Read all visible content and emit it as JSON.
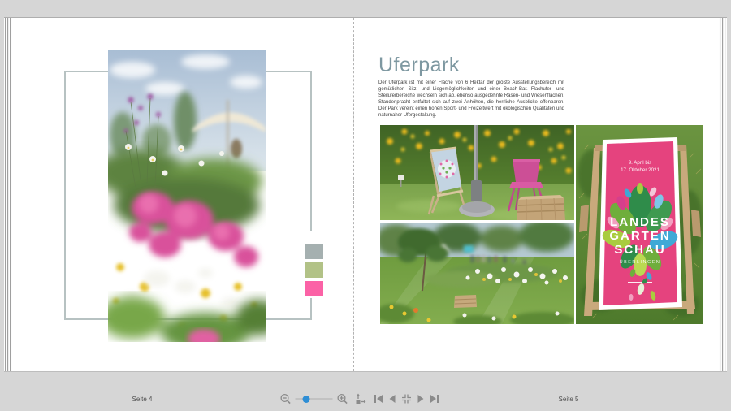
{
  "app": {
    "view": "photobook-two-page-spread-preview"
  },
  "colors": {
    "background": "#d6d6d6",
    "page": "#ffffff",
    "title": "#7e98a1",
    "frame_border": "#b7c2c2",
    "slider_thumb": "#2e8ed5",
    "icon_gray": "#8b8b8b",
    "banner_pink": "#e5437e"
  },
  "book": {
    "left_page": {
      "photo": {
        "name": "flower-meadow-umbrella-photo",
        "description": "vertical photo of pink flower meadow with white parasol and blue sky"
      },
      "swatches": [
        {
          "name": "swatch-gray",
          "color": "#a5b0b0"
        },
        {
          "name": "swatch-green",
          "color": "#b2c287"
        },
        {
          "name": "swatch-pink",
          "color": "#fb62a6"
        }
      ]
    },
    "right_page": {
      "title": "Uferpark",
      "body": "Der Uferpark ist mit einer Fläche von 6 Hektar der größte Ausstellungsbereich mit gemütlichen Sitz- und Liegemöglichkeiten und einer Beach-Bar. Flachufer- und Steiluferbereiche wechseln sich ab, ebenso ausgedehnte Rasen- und Wiesenflächen. Staudenpracht entfaltet sich auf zwei Anhöhen, die herrliche Ausblicke offenbaren. Der Park vereint einen hohen Sport- und Freizeitwert mit ökologischen Qualitäten und naturnaher Ufergestaltung.",
      "photos": [
        {
          "name": "deckchair-pink-chair-photo",
          "description": "deckchair, pink chair, parasol base and wooden crate in front of yellow flowers"
        },
        {
          "name": "park-lawn-visitors-photo",
          "description": "lawn with flower beds, trees and visitors"
        },
        {
          "name": "landesgartenschau-deckchair-photo",
          "description": "top view of deckchair with pink Landesgartenschau banner on grass"
        }
      ],
      "banner": {
        "dates_line1": "9. April bis",
        "dates_line2": "17. Oktober 2021",
        "title_line1": "LANDES",
        "title_line2": "GARTEN",
        "title_line3": "SCHAU",
        "subtitle": "ÜBERLINGEN"
      }
    }
  },
  "toolbar": {
    "left_page_label": "Seite 4",
    "right_page_label": "Seite 5",
    "slider": {
      "thumb_position_percent": 27,
      "thumb_color": "#2e8ed5"
    },
    "icons": [
      {
        "name": "zoom-out-icon",
        "glyph": "magnifier-minus"
      },
      {
        "name": "zoom-in-icon",
        "glyph": "magnifier-plus"
      },
      {
        "name": "fit-page-icon",
        "glyph": "resize-arrows"
      },
      {
        "name": "first-page-icon",
        "glyph": "bar-left-triangle"
      },
      {
        "name": "previous-page-icon",
        "glyph": "left-triangle"
      },
      {
        "name": "fit-screen-icon",
        "glyph": "compress-arrows"
      },
      {
        "name": "next-page-icon",
        "glyph": "right-triangle"
      },
      {
        "name": "last-page-icon",
        "glyph": "right-triangle-bar"
      }
    ]
  }
}
